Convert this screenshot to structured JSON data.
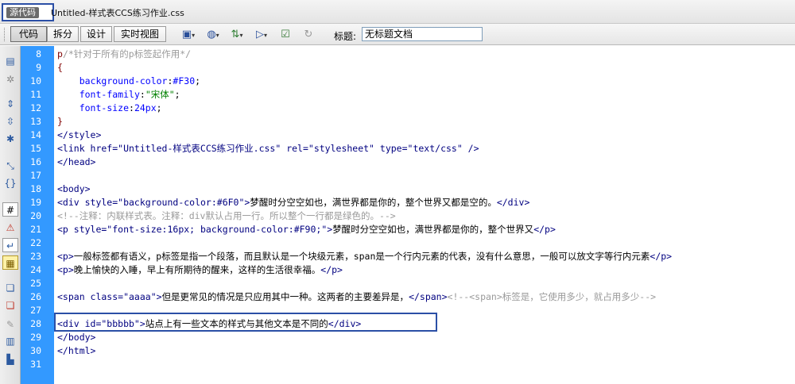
{
  "tab": {
    "source_label": "源代码",
    "document_name": "Untitled-样式表CCS练习作业.css"
  },
  "toolbar": {
    "views": [
      "代码",
      "拆分",
      "设计",
      "实时视图"
    ],
    "title_label": "标题:",
    "title_value": "无标题文档",
    "icons": [
      "multiscreen-icon",
      "browser-preview-icon",
      "file-management-icon",
      "visual-aids-icon",
      "validate-icon",
      "refresh-icon"
    ]
  },
  "sidebar": {
    "icons": [
      "open-documents-icon",
      "show-code-navigator-icon",
      "collapse-full-tag-icon",
      "collapse-selection-icon",
      "expand-all-icon",
      "select-parent-tag-icon",
      "balance-braces-icon",
      "line-numbers-icon",
      "highlight-invalid-code-icon",
      "word-wrap-icon",
      "syntax-coloring-icon",
      "apply-comment-icon",
      "remove-comment-icon",
      "wrap-tag-icon",
      "recent-snippets-icon",
      "move-css-icon"
    ]
  },
  "editor": {
    "lines": [
      {
        "n": "8",
        "segs": [
          [
            "p",
            "p"
          ],
          [
            "c",
            "/*针对于所有的p标签起作用*/"
          ]
        ]
      },
      {
        "n": "9",
        "segs": [
          [
            "p",
            "{"
          ]
        ]
      },
      {
        "n": "10",
        "segs": [
          [
            "x",
            "    "
          ],
          [
            "v",
            "background-color"
          ],
          [
            "x",
            ":"
          ],
          [
            "v",
            "#F30"
          ],
          [
            "x",
            ";"
          ]
        ]
      },
      {
        "n": "11",
        "segs": [
          [
            "x",
            "    "
          ],
          [
            "v",
            "font-family"
          ],
          [
            "x",
            ":"
          ],
          [
            "s",
            "\"宋体\""
          ],
          [
            "x",
            ";"
          ]
        ]
      },
      {
        "n": "12",
        "segs": [
          [
            "x",
            "    "
          ],
          [
            "v",
            "font-size"
          ],
          [
            "x",
            ":"
          ],
          [
            "v",
            "24px"
          ],
          [
            "x",
            ";"
          ]
        ]
      },
      {
        "n": "13",
        "segs": [
          [
            "p",
            "}"
          ]
        ]
      },
      {
        "n": "14",
        "segs": [
          [
            "t",
            "</style>"
          ]
        ]
      },
      {
        "n": "15",
        "segs": [
          [
            "t",
            "<link href=\"Untitled-样式表CCS练习作业.css\" rel=\"stylesheet\" type=\"text/css\" />"
          ]
        ]
      },
      {
        "n": "16",
        "segs": [
          [
            "t",
            "</head>"
          ]
        ]
      },
      {
        "n": "17",
        "segs": []
      },
      {
        "n": "18",
        "segs": [
          [
            "t",
            "<body>"
          ]
        ]
      },
      {
        "n": "19",
        "segs": [
          [
            "t",
            "<div style=\"background-color:#6F0\">"
          ],
          [
            "x",
            "梦醒时分空空如也，满世界都是你的，整个世界又都是空的。"
          ],
          [
            "t",
            "</div>"
          ]
        ]
      },
      {
        "n": "20",
        "segs": [
          [
            "c",
            "<!--注释：内联样式表。注释：div默认占用一行。所以整个一行都是绿色的。-->"
          ]
        ]
      },
      {
        "n": "21",
        "segs": [
          [
            "t",
            "<p style=\"font-size:16px; background-color:#F90;\">"
          ],
          [
            "x",
            "梦醒时分空空如也，满世界都是你的，整个世界又"
          ],
          [
            "t",
            "</p>"
          ]
        ]
      },
      {
        "n": "22",
        "segs": []
      },
      {
        "n": "23",
        "segs": [
          [
            "t",
            "<p>"
          ],
          [
            "x",
            "一般标签都有语义，p标签是指一个段落，而且默认是一个块级元素，span是一个行内元素的代表，没有什么意思，一般可以放文字等行内元素"
          ],
          [
            "t",
            "</p>"
          ]
        ]
      },
      {
        "n": "24",
        "segs": [
          [
            "t",
            "<p>"
          ],
          [
            "x",
            "晚上愉快的入睡，早上有所期待的醒来，这样的生活很幸福。"
          ],
          [
            "t",
            "</p>"
          ]
        ]
      },
      {
        "n": "25",
        "segs": []
      },
      {
        "n": "26",
        "segs": [
          [
            "t",
            "<span class=\"aaaa\">"
          ],
          [
            "x",
            "但是更常见的情况是只应用其中一种。这两者的主要差异是，"
          ],
          [
            "t",
            "</span>"
          ],
          [
            "c",
            "<!--<span>标签是，它使用多少，就占用多少-->"
          ]
        ]
      },
      {
        "n": "27",
        "segs": []
      },
      {
        "n": "28",
        "segs": [
          [
            "t",
            "<div id=\"bbbbb\">"
          ],
          [
            "x",
            "站点上有一些文本的样式与其他文本是不同的"
          ],
          [
            "t",
            "</div>"
          ]
        ]
      },
      {
        "n": "29",
        "segs": [
          [
            "t",
            "</body>"
          ]
        ]
      },
      {
        "n": "30",
        "segs": [
          [
            "t",
            "</html>"
          ]
        ]
      },
      {
        "n": "31",
        "segs": []
      }
    ]
  }
}
